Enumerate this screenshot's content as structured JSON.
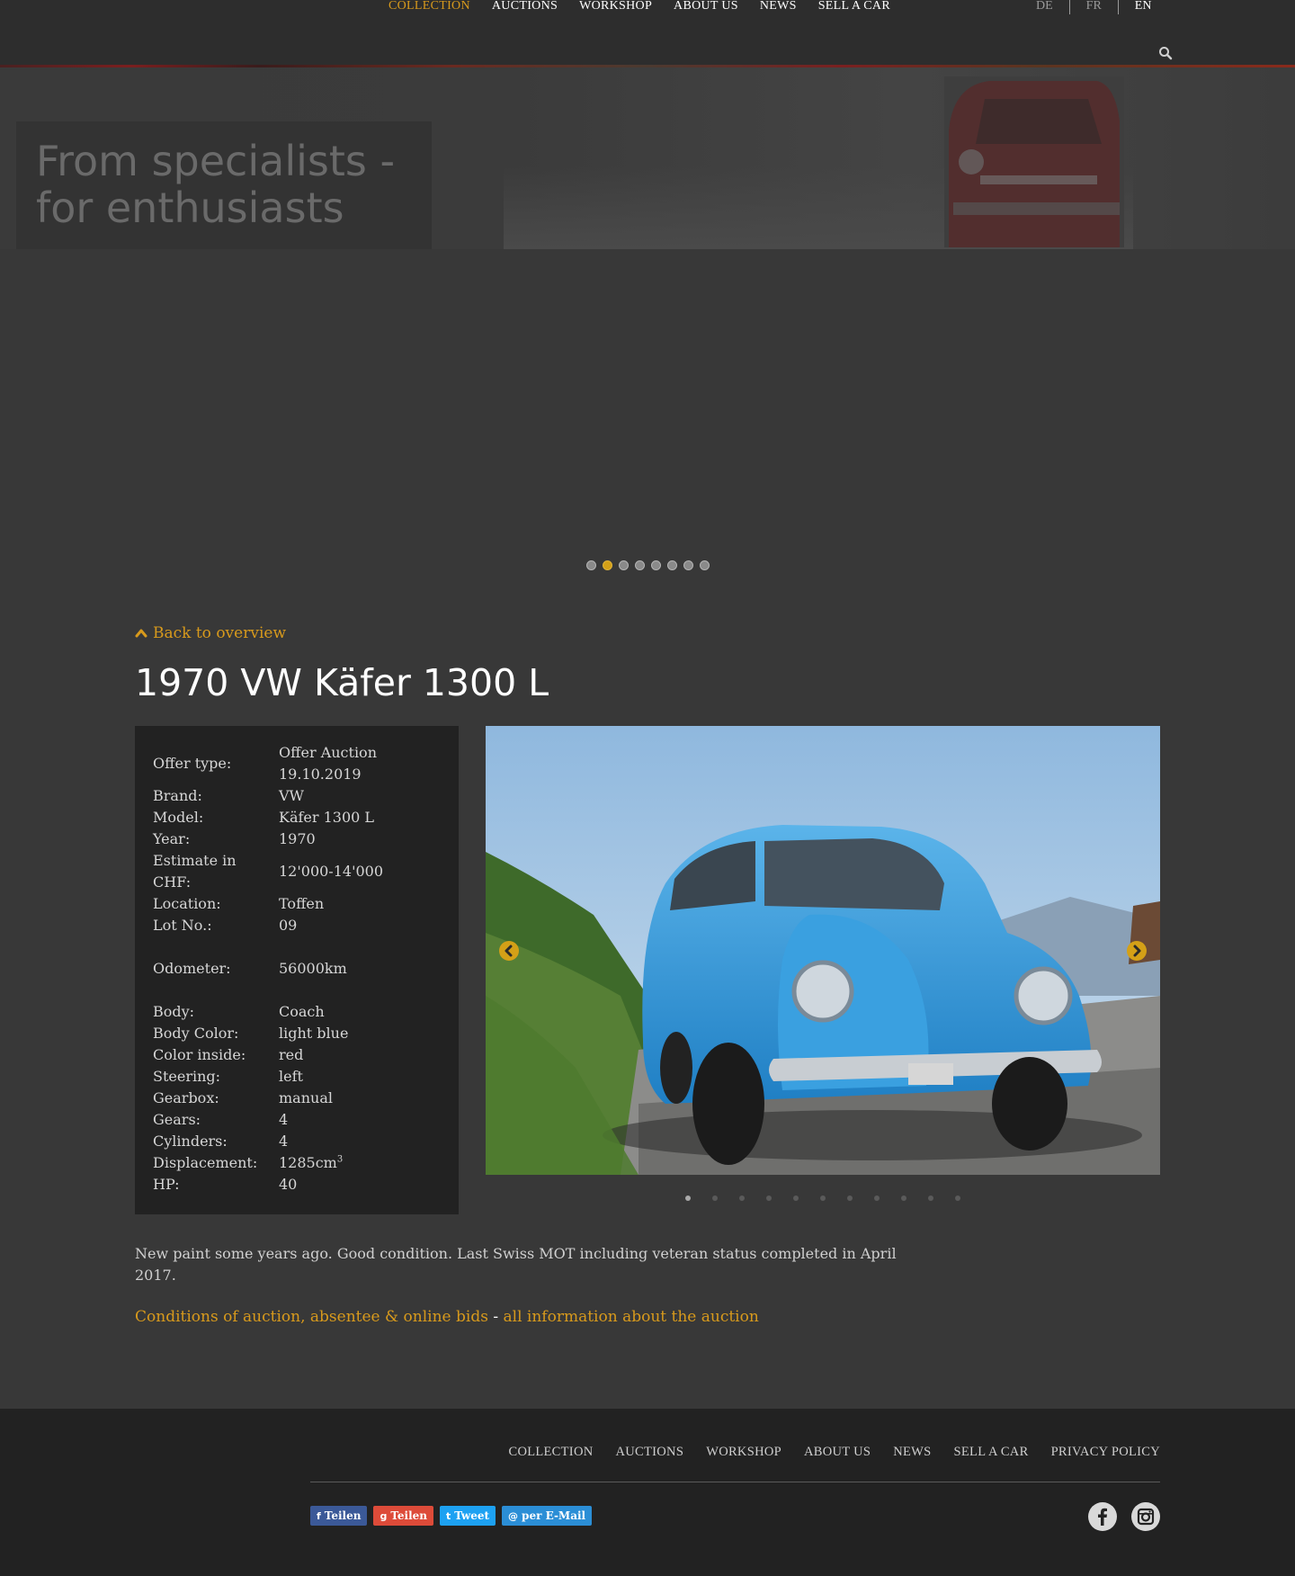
{
  "header": {
    "nav": [
      "COLLECTION",
      "AUCTIONS",
      "WORKSHOP",
      "ABOUT US",
      "NEWS",
      "SELL A CAR"
    ],
    "active_nav": "COLLECTION",
    "languages": [
      "DE",
      "FR",
      "EN"
    ],
    "current_language": "EN",
    "search_icon": "search-icon"
  },
  "hero": {
    "caption": "From specialists - for enthusiasts",
    "slide_count": 8,
    "active_slide": 2
  },
  "listing": {
    "back_link": "Back to overview",
    "title": "1970 VW Käfer 1300 L",
    "specs": [
      {
        "label": "Offer type:",
        "value": "Offer Auction 19.10.2019"
      },
      {
        "label": "Brand:",
        "value": "VW"
      },
      {
        "label": "Model:",
        "value": "Käfer 1300 L"
      },
      {
        "label": "Year:",
        "value": "1970"
      },
      {
        "label": "Estimate in CHF:",
        "value": "12'000-14'000"
      },
      {
        "label": "Location:",
        "value": "Toffen"
      },
      {
        "label": "Lot No.:",
        "value": "09"
      },
      {
        "label": "Odometer:",
        "value": "56000km"
      },
      {
        "label": "Body:",
        "value": "Coach"
      },
      {
        "label": "Body Color:",
        "value": "light blue"
      },
      {
        "label": "Color inside:",
        "value": "red"
      },
      {
        "label": "Steering:",
        "value": "left"
      },
      {
        "label": "Gearbox:",
        "value": "manual"
      },
      {
        "label": "Gears:",
        "value": "4"
      },
      {
        "label": "Cylinders:",
        "value": "4"
      },
      {
        "label": "Displacement:",
        "value": "1285cm",
        "sup": "3"
      },
      {
        "label": "HP:",
        "value": "40"
      }
    ],
    "gallery_count": 11,
    "gallery_active": 1,
    "description": "New paint some years ago. Good condition. Last Swiss MOT including veteran status completed in April 2017.",
    "auction_link_1": "Conditions of auction, absentee & online bids",
    "auction_separator": " - ",
    "auction_link_2": "all information about the auction"
  },
  "footer": {
    "nav": [
      "COLLECTION",
      "AUCTIONS",
      "WORKSHOP",
      "ABOUT US",
      "NEWS",
      "SELL A CAR",
      "PRIVACY POLICY"
    ],
    "share": [
      {
        "label": "Teilen",
        "icon": "f",
        "color": "#3b5998"
      },
      {
        "label": "Teilen",
        "icon": "g",
        "color": "#dd4b39"
      },
      {
        "label": "Tweet",
        "icon": "t",
        "color": "#1da1f2"
      },
      {
        "label": "per E-Mail",
        "icon": "@",
        "color": "#2b8ed6"
      }
    ]
  },
  "colors": {
    "accent": "#d89a1c",
    "bg": "#383838",
    "panel": "#222222"
  }
}
